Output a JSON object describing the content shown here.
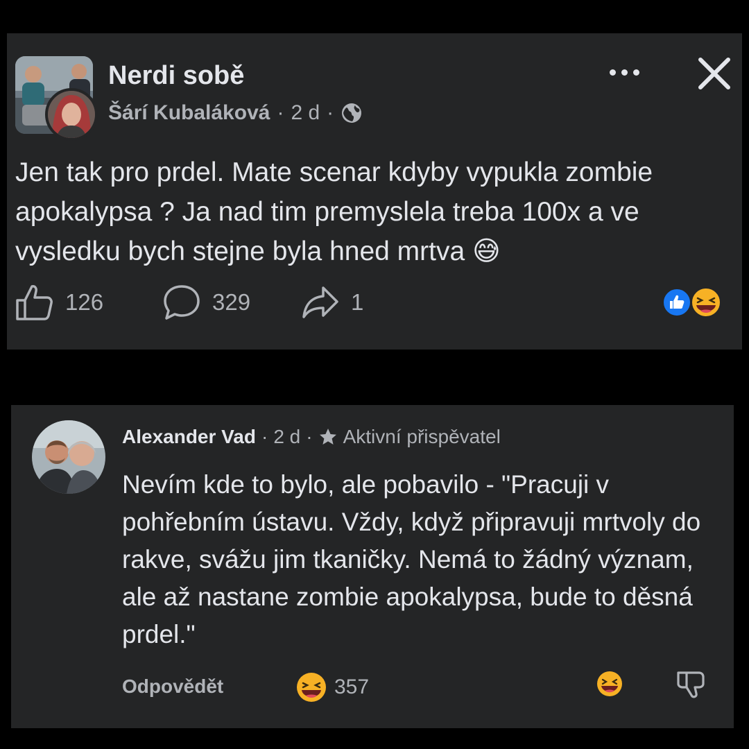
{
  "post": {
    "group_name": "Nerdi sobě",
    "author": "Šárí Kubaláková",
    "time": "2 d",
    "separator": "·",
    "text": "Jen tak pro prdel. Mate scenar kdyby vypukla zombie apokalypsa ? Ja nad tim premyslela treba 100x a ve vysledku bych stejne byla hned mrtva 😅",
    "likes": "126",
    "comments": "329",
    "shares": "1",
    "reaction_icons": [
      "like-reaction-icon",
      "haha-reaction-icon"
    ]
  },
  "comment": {
    "author": "Alexander Vad",
    "time": "2 d",
    "separator": "·",
    "badge": "Aktivní přispěvatel",
    "text": "Nevím kde to bylo, ale pobavilo - \"Pracuji v pohřebním ústavu. Vždy, když připravuji mrtvoly do rakve, svážu jim tkaničky. Nemá to žádný význam, ale až nastane zombie apokalypsa, bude to děsná prdel.\"",
    "reply_label": "Odpovědět",
    "reaction_count": "357"
  },
  "colors": {
    "background": "#000000",
    "card": "#242526",
    "text_primary": "#e4e6eb",
    "text_secondary": "#b0b3b8",
    "like_blue": "#1877f2",
    "haha_yellow": "#f7b125"
  }
}
